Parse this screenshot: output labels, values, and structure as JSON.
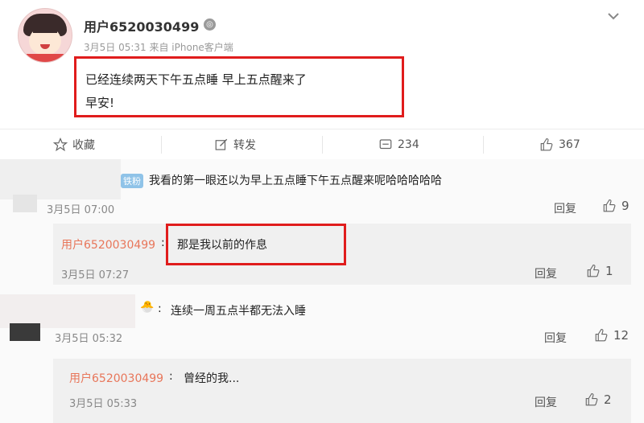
{
  "post": {
    "username": "用户6520030499",
    "vip_badge": "◎",
    "meta": "3月5日 05:31 来自 iPhone客户端",
    "line1": "已经连续两天下午五点睡 早上五点醒来了",
    "line2": "早安!"
  },
  "actions": {
    "favorite": "收藏",
    "repost": "转发",
    "comments": "234",
    "likes": "367"
  },
  "comments": [
    {
      "fan_badge": "铁粉",
      "text": "我看的第一眼还以为早上五点睡下午五点醒来呢哈哈哈哈哈",
      "time": "3月5日 07:00",
      "reply_label": "回复",
      "likes": "9",
      "reply": {
        "user": "用户6520030499",
        "sep": ":",
        "text": "那是我以前的作息",
        "time": "3月5日 07:27",
        "reply_label": "回复",
        "likes": "1"
      }
    },
    {
      "text": "连续一周五点半都无法入睡",
      "time": "3月5日 05:32",
      "reply_label": "回复",
      "likes": "12",
      "reply": {
        "user": "用户6520030499",
        "sep": ":",
        "text": "曾经的我...",
        "time": "3月5日 05:33",
        "reply_label": "回复",
        "likes": "2"
      }
    }
  ],
  "colors": {
    "highlight": "#e01c1c",
    "reply_user": "#e8765a",
    "fan_badge": "#8fc3e8"
  }
}
